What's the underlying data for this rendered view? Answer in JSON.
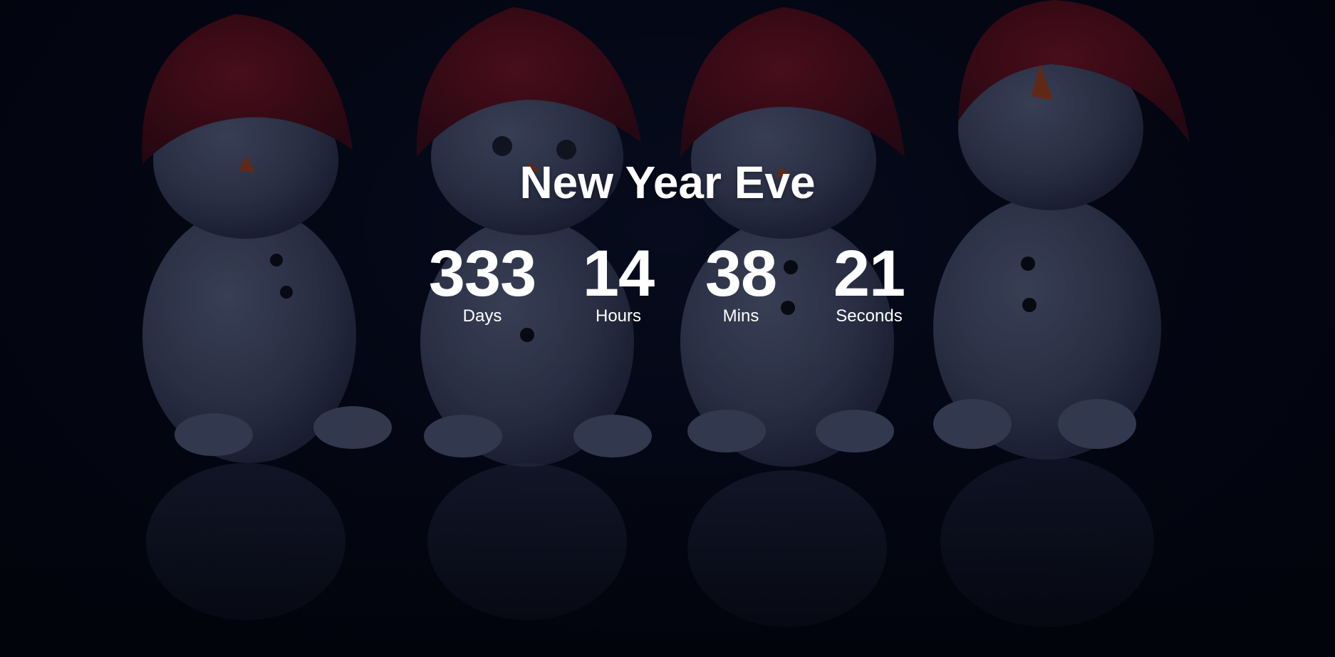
{
  "page": {
    "title": "New Year Eve"
  },
  "countdown": {
    "days": {
      "value": "333",
      "label": "Days"
    },
    "hours": {
      "value": "14",
      "label": "Hours"
    },
    "mins": {
      "value": "38",
      "label": "Mins"
    },
    "seconds": {
      "value": "21",
      "label": "Seconds"
    }
  },
  "background": {
    "description_icon": "snowmen-photo",
    "colors": {
      "backdrop": "#02040f",
      "snow_body": "#4a5270",
      "hat_red": "#5c0f1c",
      "nose_orange": "#b54a1e"
    }
  }
}
